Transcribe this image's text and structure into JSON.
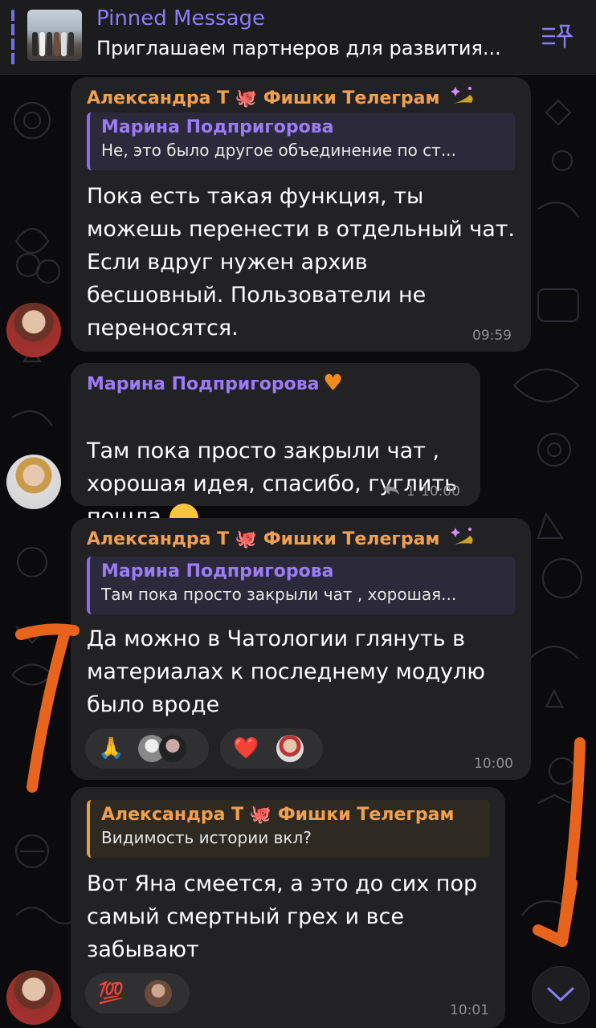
{
  "pinned": {
    "title": "Pinned Message",
    "text": "Приглашаем партнеров для развития..."
  },
  "messages": [
    {
      "sender": "Александра Т 🐙 Фишки Телеграм",
      "reply_name": "Марина Подпригорова",
      "reply_text": "Не, это было другое объединение по ст...",
      "text": "Пока есть такая функция, ты\nможешь перенести в отдельный чат.\nЕсли вдруг нужен архив\nбесшовный. Пользователи не\nпереносятся.",
      "time": "09:59"
    },
    {
      "sender": "Марина Подпригорова",
      "text": "Там пока просто закрыли чат ,\nхорошая идея, спасибо, гуглить\nпошла",
      "reply_count": "1",
      "time": "10:00"
    },
    {
      "sender": "Александра Т 🐙 Фишки Телеграм",
      "reply_name": "Марина Подпригорова",
      "reply_text": "Там пока просто закрыли чат , хорошая...",
      "text": "Да можно в Чатологии глянуть в\nматериалах к последнему модулю\nбыло вроде",
      "reactions": [
        {
          "emoji": "🙏"
        },
        {
          "emoji": "❤️"
        }
      ],
      "time": "10:00"
    },
    {
      "reply_name": "Александра Т 🐙 Фишки Телеграм",
      "reply_text": "Видимость истории вкл?",
      "text": "Вот Яна смеется, а это до сих пор\nсамый смертный грех и все\nзабывают",
      "reactions": [
        {
          "emoji": "💯"
        }
      ],
      "time": "10:01"
    }
  ],
  "icons": {
    "pinned_list": "pinned-list-icon",
    "reply_arrow": "reply-arrow-icon",
    "scroll_down": "chevron-down-icon"
  },
  "colors": {
    "accent_purple": "#8b7cf7",
    "sender_orange": "#f0a050",
    "bubble": "#222224",
    "annotation_orange": "#e8641c"
  }
}
